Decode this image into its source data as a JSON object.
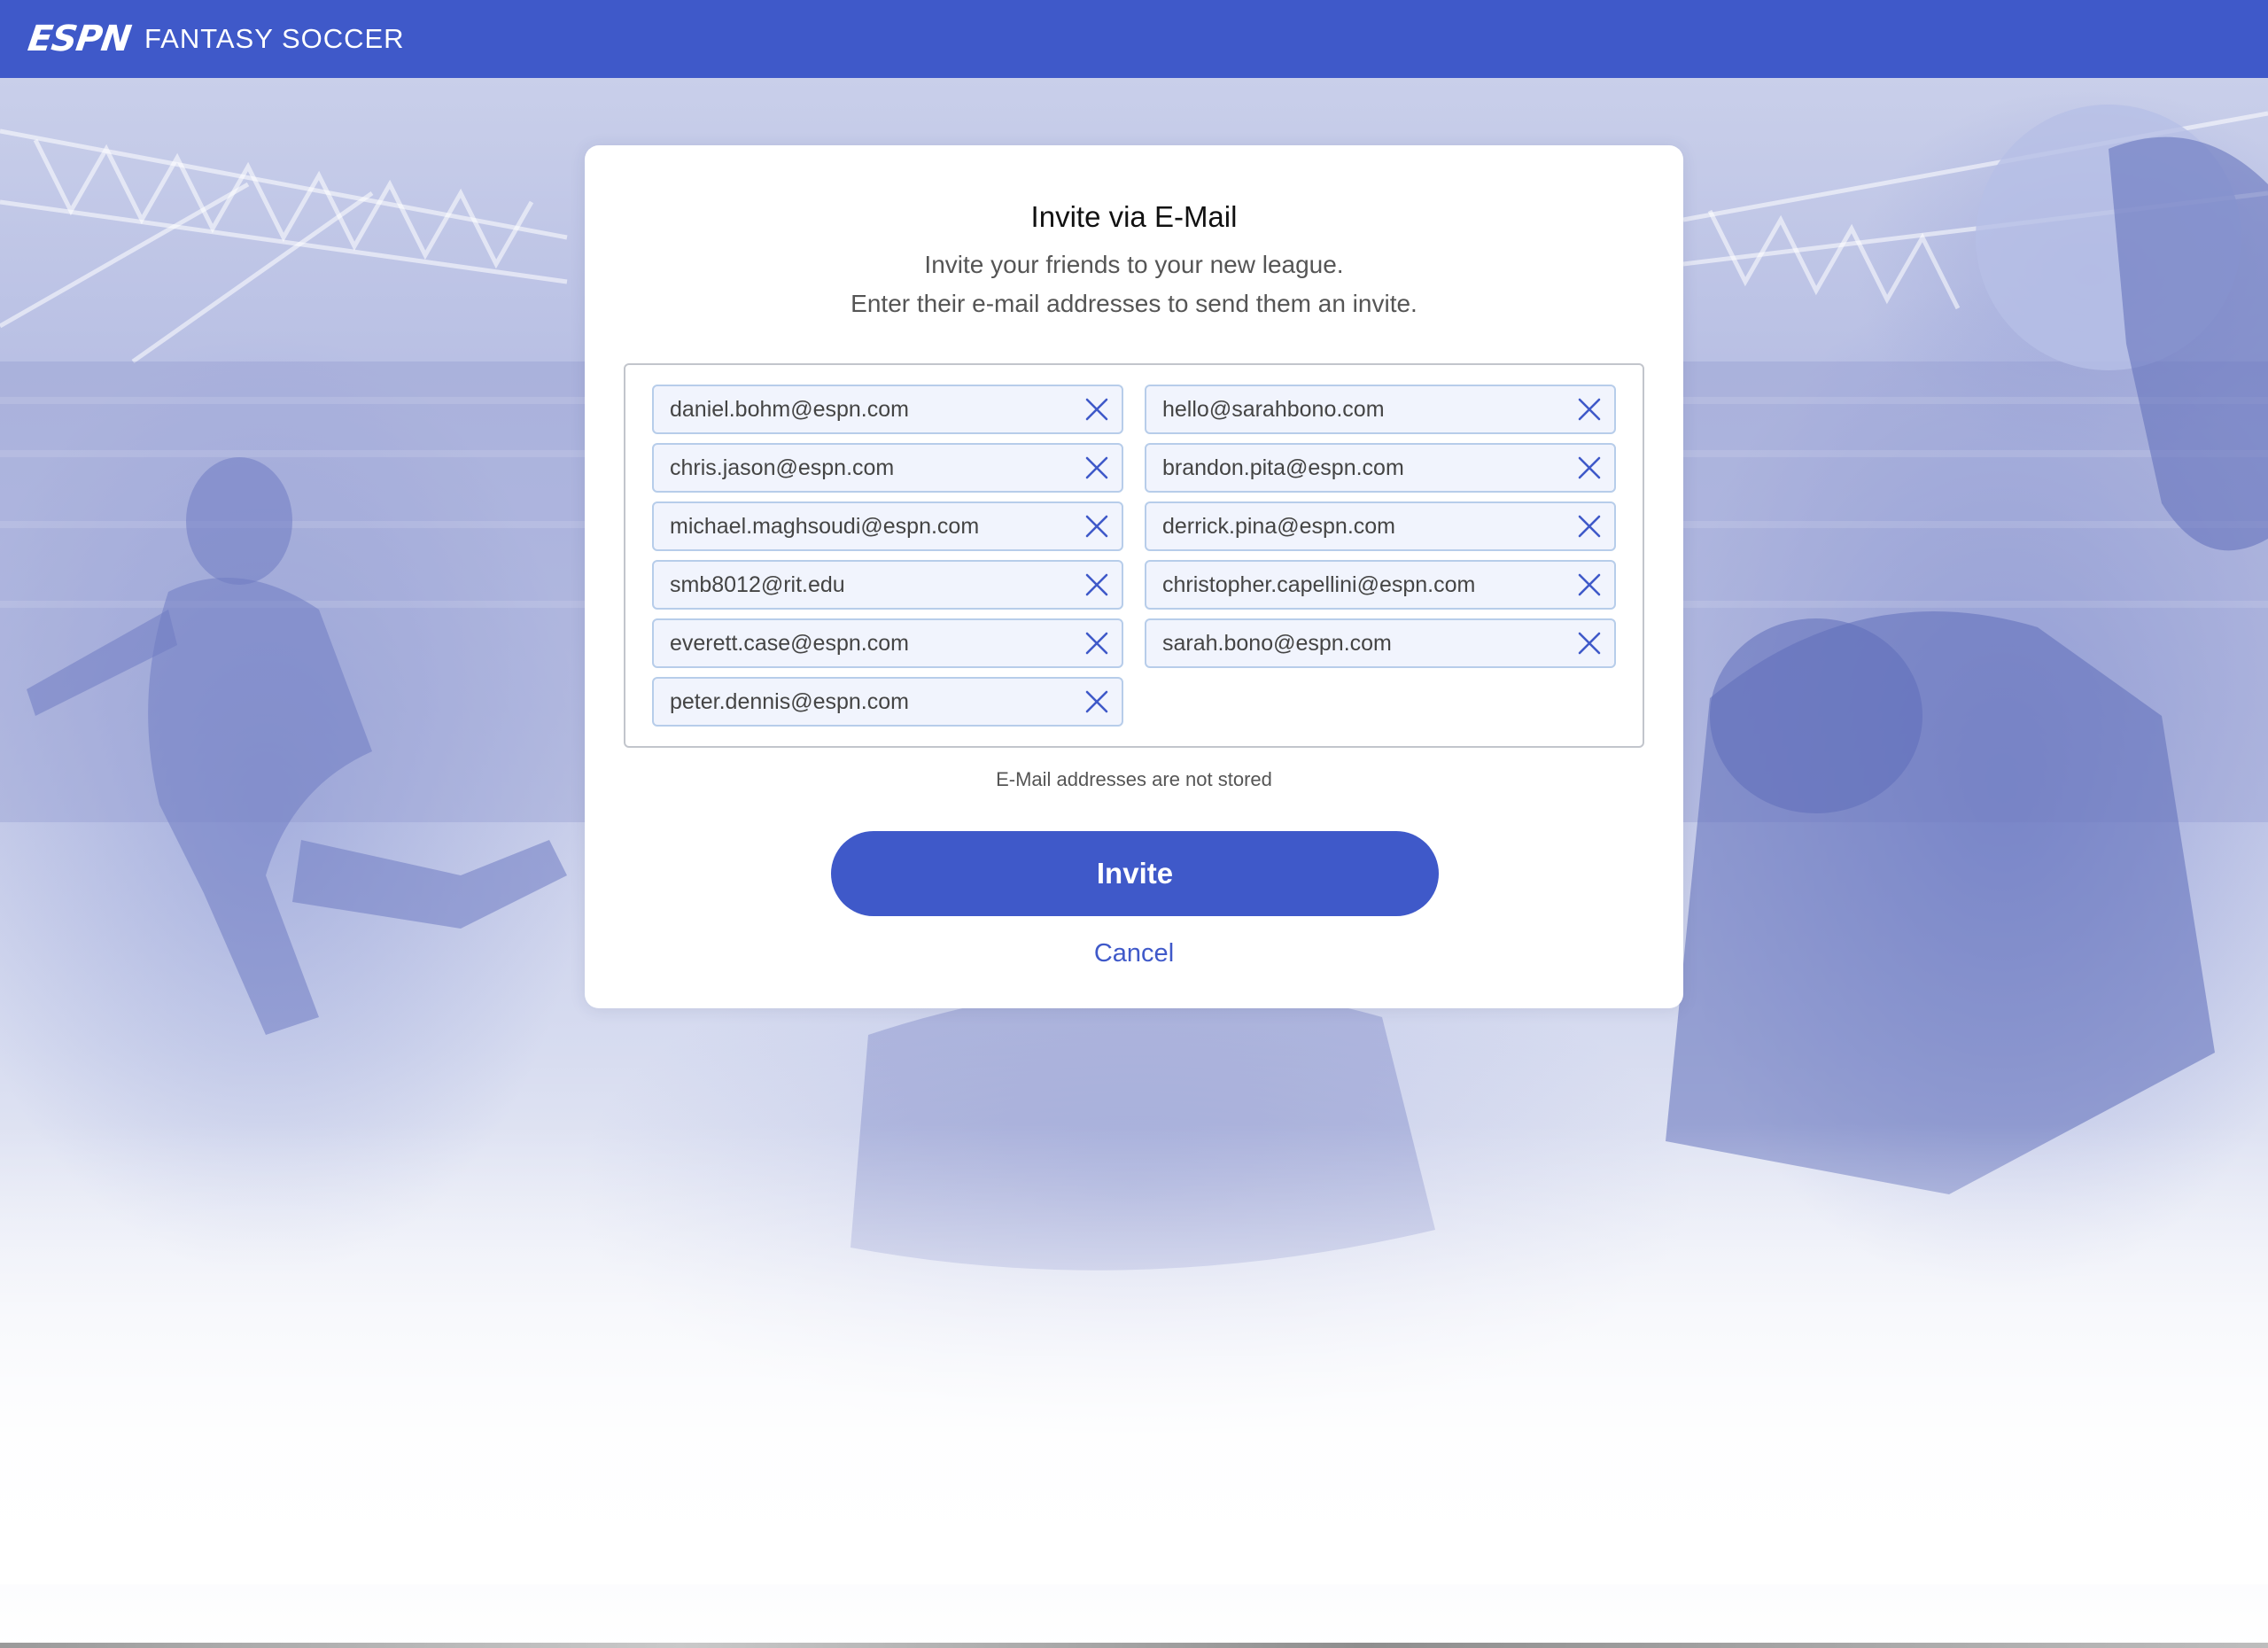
{
  "header": {
    "logo": "ESPN",
    "title": "FANTASY SOCCER",
    "background": "#3f59c9"
  },
  "modal": {
    "title": "Invite via E-Mail",
    "subtitle_line1": "Invite your friends to your new league.",
    "subtitle_line2": "Enter their e-mail addresses to send them an invite.",
    "emails": [
      "daniel.bohm@espn.com",
      "hello@sarahbono.com",
      "chris.jason@espn.com",
      "brandon.pita@espn.com",
      "michael.maghsoudi@espn.com",
      "derrick.pina@espn.com",
      "smb8012@rit.edu",
      "christopher.capellini@espn.com",
      "everett.case@espn.com",
      "sarah.bono@espn.com",
      "peter.dennis@espn.com"
    ],
    "remove_icon": "close-icon",
    "note": "E-Mail addresses are not stored",
    "invite_label": "Invite",
    "cancel_label": "Cancel",
    "accent": "#3f59c9",
    "chip_background": "#f1f4fd",
    "chip_border": "#b7cdea"
  }
}
